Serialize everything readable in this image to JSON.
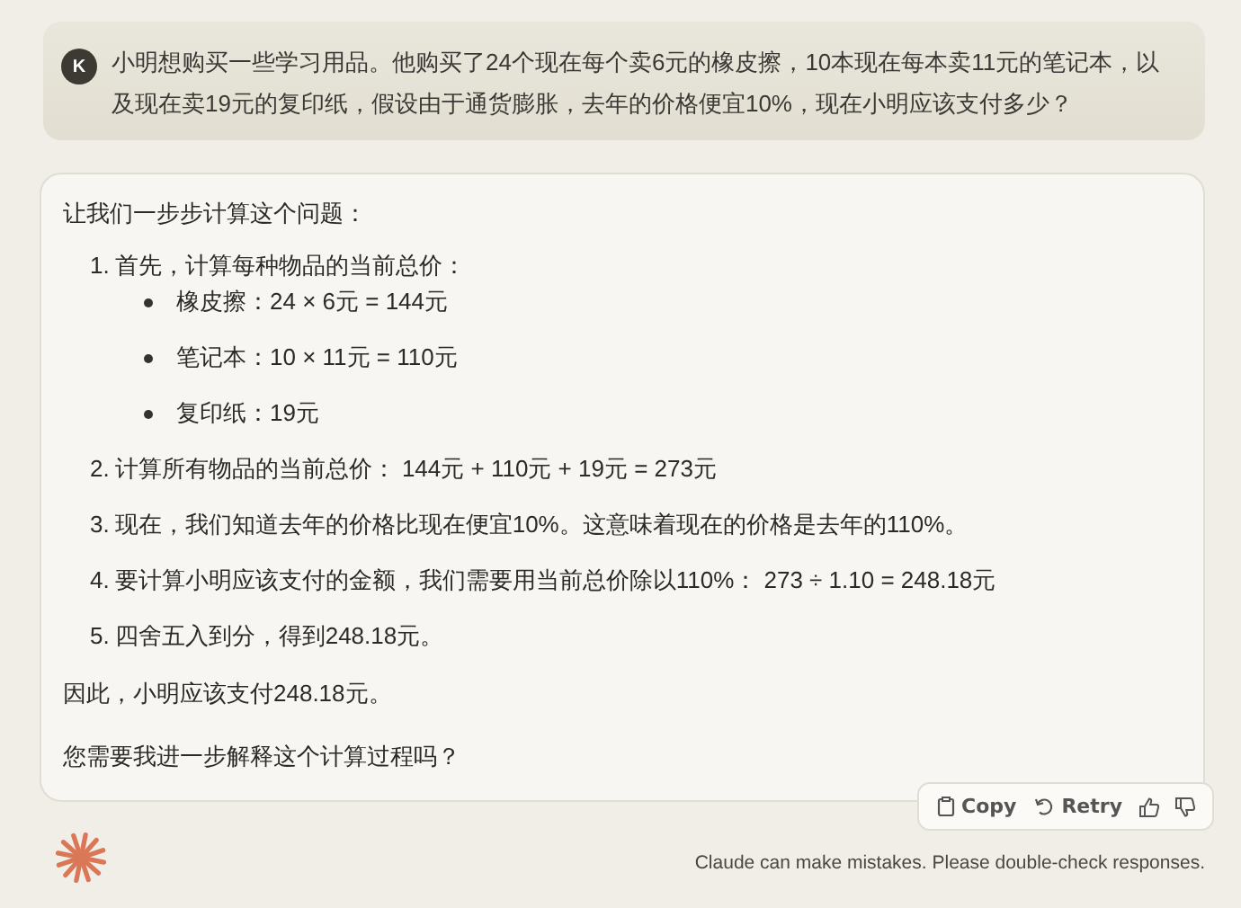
{
  "user_message": {
    "avatar": "K",
    "text": "小明想购买一些学习用品。他购买了24个现在每个卖6元的橡皮擦，10本现在每本卖11元的笔记本，以及现在卖19元的复印纸，假设由于通货膨胀，去年的价格便宜10%，现在小明应该支付多少？"
  },
  "response": {
    "intro": "让我们一步步计算这个问题：",
    "steps": [
      {
        "number": "1.",
        "text": "首先，计算每种物品的当前总价：",
        "bullets": [
          "橡皮擦：24 × 6元 = 144元",
          "笔记本：10 × 11元 = 110元",
          "复印纸：19元"
        ]
      },
      {
        "number": "2.",
        "text": "计算所有物品的当前总价： 144元 + 110元 + 19元 = 273元"
      },
      {
        "number": "3.",
        "text": "现在，我们知道去年的价格比现在便宜10%。这意味着现在的价格是去年的110%。"
      },
      {
        "number": "4.",
        "text": "要计算小明应该支付的金额，我们需要用当前总价除以110%： 273 ÷ 1.10 = 248.18元"
      },
      {
        "number": "5.",
        "text": "四舍五入到分，得到248.18元。"
      }
    ],
    "conclusion": "因此，小明应该支付248.18元。",
    "followup": "您需要我进一步解释这个计算过程吗？"
  },
  "actions": [
    {
      "kind": "copy",
      "label": "Copy"
    },
    {
      "kind": "retry",
      "label": "Retry"
    },
    {
      "kind": "thumbs-up"
    },
    {
      "kind": "thumbs-down"
    }
  ],
  "disclaimer": "Claude can make mistakes. Please double-check responses."
}
